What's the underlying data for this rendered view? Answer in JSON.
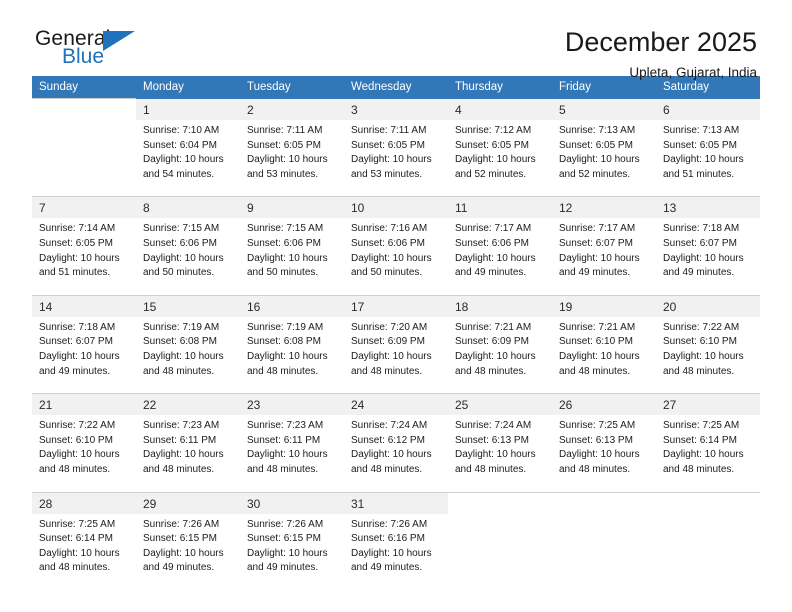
{
  "brand": {
    "name_part1": "General",
    "name_part2": "Blue"
  },
  "header": {
    "title": "December 2025",
    "location": "Upleta, Gujarat, India"
  },
  "calendar": {
    "weekday_headers": [
      "Sunday",
      "Monday",
      "Tuesday",
      "Wednesday",
      "Thursday",
      "Friday",
      "Saturday"
    ],
    "colors": {
      "header_blue": "#3277b8",
      "daynum_band": "#f1f1f1",
      "brand_blue": "#1f72bb",
      "text": "#1a1a1a"
    },
    "labels": {
      "sunrise_prefix": "Sunrise: ",
      "sunset_prefix": "Sunset: ",
      "daylight_prefix": "Daylight: "
    },
    "weeks": [
      [
        {
          "day": "",
          "empty": true
        },
        {
          "day": "1",
          "sunrise": "Sunrise: 7:10 AM",
          "sunset": "Sunset: 6:04 PM",
          "daylight_line1": "Daylight: 10 hours",
          "daylight_line2": "and 54 minutes."
        },
        {
          "day": "2",
          "sunrise": "Sunrise: 7:11 AM",
          "sunset": "Sunset: 6:05 PM",
          "daylight_line1": "Daylight: 10 hours",
          "daylight_line2": "and 53 minutes."
        },
        {
          "day": "3",
          "sunrise": "Sunrise: 7:11 AM",
          "sunset": "Sunset: 6:05 PM",
          "daylight_line1": "Daylight: 10 hours",
          "daylight_line2": "and 53 minutes."
        },
        {
          "day": "4",
          "sunrise": "Sunrise: 7:12 AM",
          "sunset": "Sunset: 6:05 PM",
          "daylight_line1": "Daylight: 10 hours",
          "daylight_line2": "and 52 minutes."
        },
        {
          "day": "5",
          "sunrise": "Sunrise: 7:13 AM",
          "sunset": "Sunset: 6:05 PM",
          "daylight_line1": "Daylight: 10 hours",
          "daylight_line2": "and 52 minutes."
        },
        {
          "day": "6",
          "sunrise": "Sunrise: 7:13 AM",
          "sunset": "Sunset: 6:05 PM",
          "daylight_line1": "Daylight: 10 hours",
          "daylight_line2": "and 51 minutes."
        }
      ],
      [
        {
          "day": "7",
          "sunrise": "Sunrise: 7:14 AM",
          "sunset": "Sunset: 6:05 PM",
          "daylight_line1": "Daylight: 10 hours",
          "daylight_line2": "and 51 minutes."
        },
        {
          "day": "8",
          "sunrise": "Sunrise: 7:15 AM",
          "sunset": "Sunset: 6:06 PM",
          "daylight_line1": "Daylight: 10 hours",
          "daylight_line2": "and 50 minutes."
        },
        {
          "day": "9",
          "sunrise": "Sunrise: 7:15 AM",
          "sunset": "Sunset: 6:06 PM",
          "daylight_line1": "Daylight: 10 hours",
          "daylight_line2": "and 50 minutes."
        },
        {
          "day": "10",
          "sunrise": "Sunrise: 7:16 AM",
          "sunset": "Sunset: 6:06 PM",
          "daylight_line1": "Daylight: 10 hours",
          "daylight_line2": "and 50 minutes."
        },
        {
          "day": "11",
          "sunrise": "Sunrise: 7:17 AM",
          "sunset": "Sunset: 6:06 PM",
          "daylight_line1": "Daylight: 10 hours",
          "daylight_line2": "and 49 minutes."
        },
        {
          "day": "12",
          "sunrise": "Sunrise: 7:17 AM",
          "sunset": "Sunset: 6:07 PM",
          "daylight_line1": "Daylight: 10 hours",
          "daylight_line2": "and 49 minutes."
        },
        {
          "day": "13",
          "sunrise": "Sunrise: 7:18 AM",
          "sunset": "Sunset: 6:07 PM",
          "daylight_line1": "Daylight: 10 hours",
          "daylight_line2": "and 49 minutes."
        }
      ],
      [
        {
          "day": "14",
          "sunrise": "Sunrise: 7:18 AM",
          "sunset": "Sunset: 6:07 PM",
          "daylight_line1": "Daylight: 10 hours",
          "daylight_line2": "and 49 minutes."
        },
        {
          "day": "15",
          "sunrise": "Sunrise: 7:19 AM",
          "sunset": "Sunset: 6:08 PM",
          "daylight_line1": "Daylight: 10 hours",
          "daylight_line2": "and 48 minutes."
        },
        {
          "day": "16",
          "sunrise": "Sunrise: 7:19 AM",
          "sunset": "Sunset: 6:08 PM",
          "daylight_line1": "Daylight: 10 hours",
          "daylight_line2": "and 48 minutes."
        },
        {
          "day": "17",
          "sunrise": "Sunrise: 7:20 AM",
          "sunset": "Sunset: 6:09 PM",
          "daylight_line1": "Daylight: 10 hours",
          "daylight_line2": "and 48 minutes."
        },
        {
          "day": "18",
          "sunrise": "Sunrise: 7:21 AM",
          "sunset": "Sunset: 6:09 PM",
          "daylight_line1": "Daylight: 10 hours",
          "daylight_line2": "and 48 minutes."
        },
        {
          "day": "19",
          "sunrise": "Sunrise: 7:21 AM",
          "sunset": "Sunset: 6:10 PM",
          "daylight_line1": "Daylight: 10 hours",
          "daylight_line2": "and 48 minutes."
        },
        {
          "day": "20",
          "sunrise": "Sunrise: 7:22 AM",
          "sunset": "Sunset: 6:10 PM",
          "daylight_line1": "Daylight: 10 hours",
          "daylight_line2": "and 48 minutes."
        }
      ],
      [
        {
          "day": "21",
          "sunrise": "Sunrise: 7:22 AM",
          "sunset": "Sunset: 6:10 PM",
          "daylight_line1": "Daylight: 10 hours",
          "daylight_line2": "and 48 minutes."
        },
        {
          "day": "22",
          "sunrise": "Sunrise: 7:23 AM",
          "sunset": "Sunset: 6:11 PM",
          "daylight_line1": "Daylight: 10 hours",
          "daylight_line2": "and 48 minutes."
        },
        {
          "day": "23",
          "sunrise": "Sunrise: 7:23 AM",
          "sunset": "Sunset: 6:11 PM",
          "daylight_line1": "Daylight: 10 hours",
          "daylight_line2": "and 48 minutes."
        },
        {
          "day": "24",
          "sunrise": "Sunrise: 7:24 AM",
          "sunset": "Sunset: 6:12 PM",
          "daylight_line1": "Daylight: 10 hours",
          "daylight_line2": "and 48 minutes."
        },
        {
          "day": "25",
          "sunrise": "Sunrise: 7:24 AM",
          "sunset": "Sunset: 6:13 PM",
          "daylight_line1": "Daylight: 10 hours",
          "daylight_line2": "and 48 minutes."
        },
        {
          "day": "26",
          "sunrise": "Sunrise: 7:25 AM",
          "sunset": "Sunset: 6:13 PM",
          "daylight_line1": "Daylight: 10 hours",
          "daylight_line2": "and 48 minutes."
        },
        {
          "day": "27",
          "sunrise": "Sunrise: 7:25 AM",
          "sunset": "Sunset: 6:14 PM",
          "daylight_line1": "Daylight: 10 hours",
          "daylight_line2": "and 48 minutes."
        }
      ],
      [
        {
          "day": "28",
          "sunrise": "Sunrise: 7:25 AM",
          "sunset": "Sunset: 6:14 PM",
          "daylight_line1": "Daylight: 10 hours",
          "daylight_line2": "and 48 minutes."
        },
        {
          "day": "29",
          "sunrise": "Sunrise: 7:26 AM",
          "sunset": "Sunset: 6:15 PM",
          "daylight_line1": "Daylight: 10 hours",
          "daylight_line2": "and 49 minutes."
        },
        {
          "day": "30",
          "sunrise": "Sunrise: 7:26 AM",
          "sunset": "Sunset: 6:15 PM",
          "daylight_line1": "Daylight: 10 hours",
          "daylight_line2": "and 49 minutes."
        },
        {
          "day": "31",
          "sunrise": "Sunrise: 7:26 AM",
          "sunset": "Sunset: 6:16 PM",
          "daylight_line1": "Daylight: 10 hours",
          "daylight_line2": "and 49 minutes."
        },
        {
          "day": "",
          "empty": true
        },
        {
          "day": "",
          "empty": true
        },
        {
          "day": "",
          "empty": true
        }
      ]
    ]
  }
}
